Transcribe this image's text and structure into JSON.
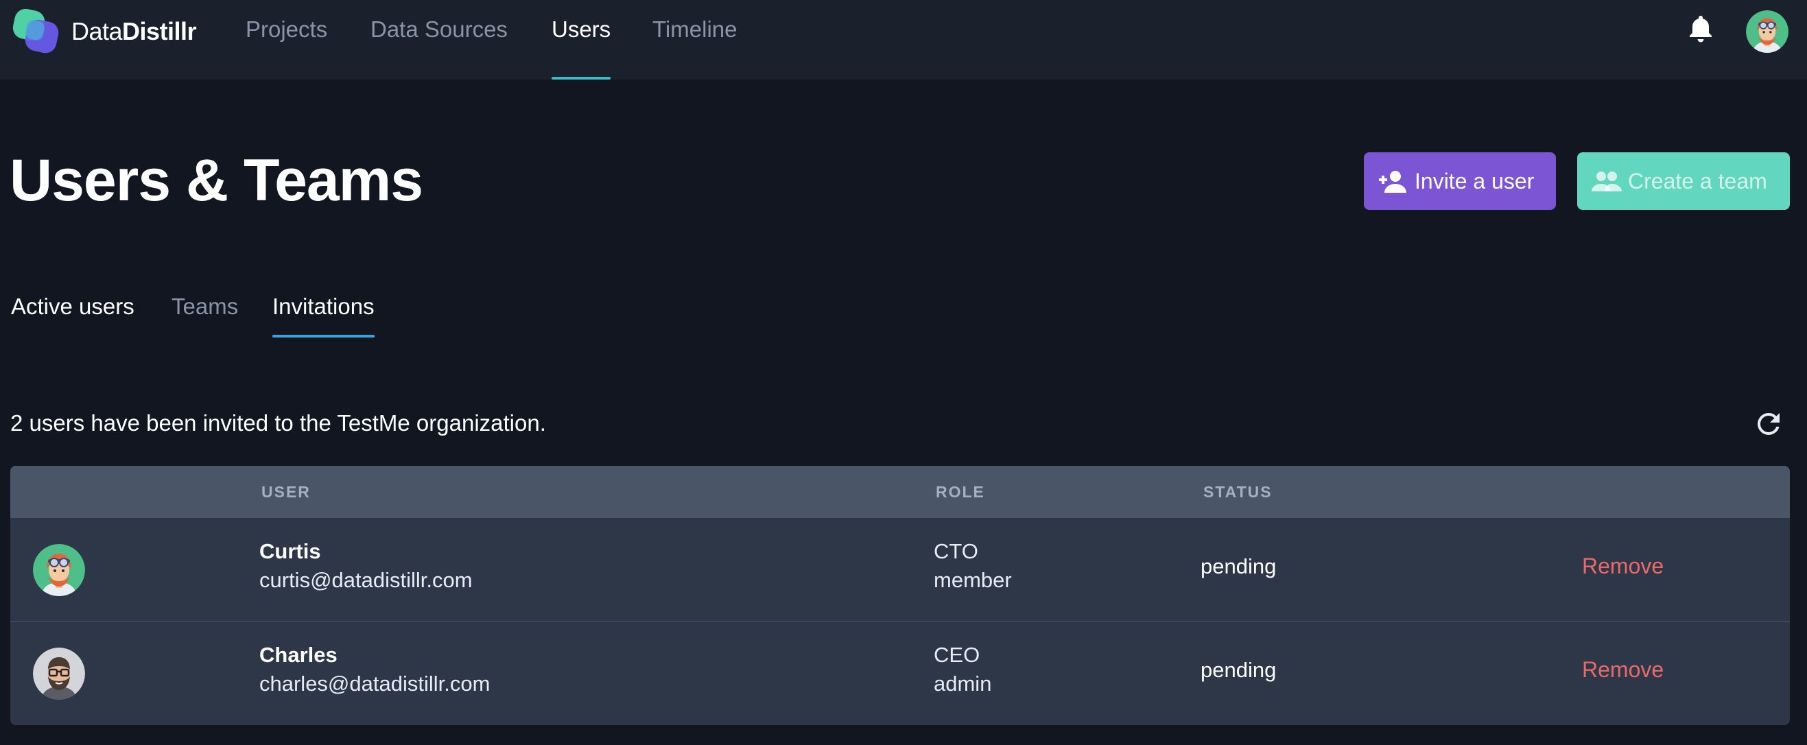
{
  "brand": {
    "name_light": "Data",
    "name_bold": "Distillr"
  },
  "nav": {
    "items": [
      {
        "label": "Projects",
        "active": false
      },
      {
        "label": "Data Sources",
        "active": false
      },
      {
        "label": "Users",
        "active": true
      },
      {
        "label": "Timeline",
        "active": false
      }
    ],
    "icons": [
      "bell-icon",
      "user-avatar"
    ]
  },
  "header": {
    "title": "Users & Teams",
    "invite_button": "Invite a user",
    "create_team_button": "Create a team"
  },
  "tabs": [
    {
      "label": "Active users",
      "active": false
    },
    {
      "label": "Teams",
      "active": false
    },
    {
      "label": "Invitations",
      "active": true
    }
  ],
  "invitations": {
    "summary": "2 users have been invited to the TestMe organization.",
    "columns": [
      "USER",
      "ROLE",
      "STATUS"
    ],
    "rows": [
      {
        "name": "Curtis",
        "email": "curtis@datadistillr.com",
        "title": "CTO",
        "role": "member",
        "status": "pending",
        "action": "Remove"
      },
      {
        "name": "Charles",
        "email": "charles@datadistillr.com",
        "title": "CEO",
        "role": "admin",
        "status": "pending",
        "action": "Remove"
      }
    ]
  },
  "colors": {
    "background": "#111621",
    "nav_background": "#1a202c",
    "invite_button": "#7c55d5",
    "team_button": "#62d6bf",
    "remove_link": "#e86a6a",
    "active_tab_underline": "#3fa0e0"
  }
}
